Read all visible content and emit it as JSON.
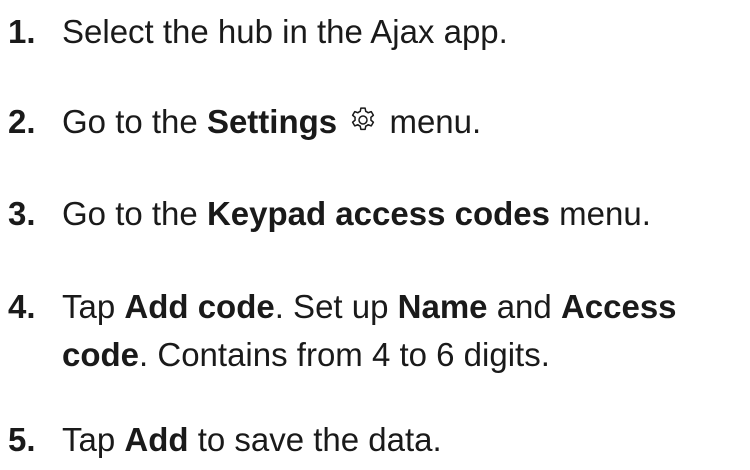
{
  "steps": [
    {
      "number": "1.",
      "t1": "Select the hub in the Ajax app."
    },
    {
      "number": "2.",
      "t1": "Go to the ",
      "b1": "Settings",
      "t2": " menu.",
      "icon": "gear-icon"
    },
    {
      "number": "3.",
      "t1": "Go to the ",
      "b1": "Keypad access codes",
      "t2": " menu."
    },
    {
      "number": "4.",
      "t1": "Tap ",
      "b1": "Add code",
      "t2": ". Set up ",
      "b2": "Name",
      "t3": " and ",
      "b3": "Access",
      "b4": "code",
      "t4": ". Contains from 4 to 6 digits."
    },
    {
      "number": "5.",
      "t1": "Tap ",
      "b1": "Add",
      "t2": " to save the data."
    }
  ]
}
